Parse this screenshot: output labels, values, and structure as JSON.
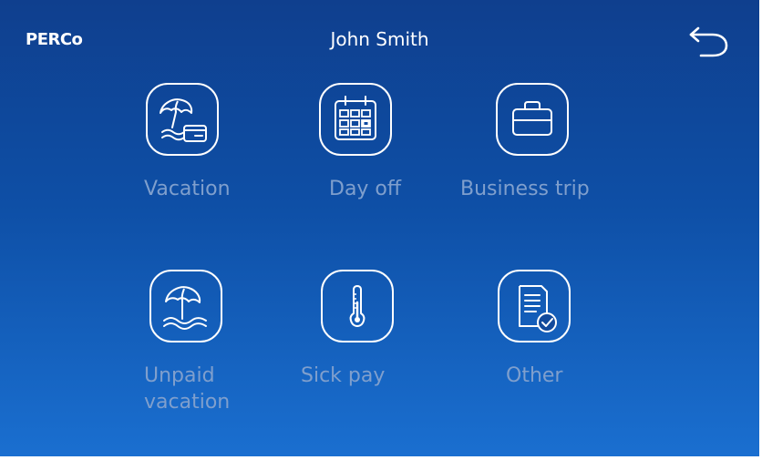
{
  "header": {
    "brand": "PERCo",
    "user_name": "John Smith",
    "back_icon": "undo-arrow-icon"
  },
  "tiles": [
    {
      "label": "Vacation",
      "icon": "beach-umbrella-card-icon"
    },
    {
      "label": "Day off",
      "icon": "calendar-icon"
    },
    {
      "label": "Business trip",
      "icon": "briefcase-icon"
    },
    {
      "label_line1": "Unpaid",
      "label_line2": "vacation",
      "icon": "beach-umbrella-waves-icon"
    },
    {
      "label": "Sick pay",
      "icon": "thermometer-icon"
    },
    {
      "label": "Other",
      "icon": "document-check-icon"
    }
  ],
  "colors": {
    "background_top": "#0f3f8e",
    "background_bottom": "#1a6fd0",
    "label": "#7f9fcd",
    "icon": "#ffffff"
  }
}
